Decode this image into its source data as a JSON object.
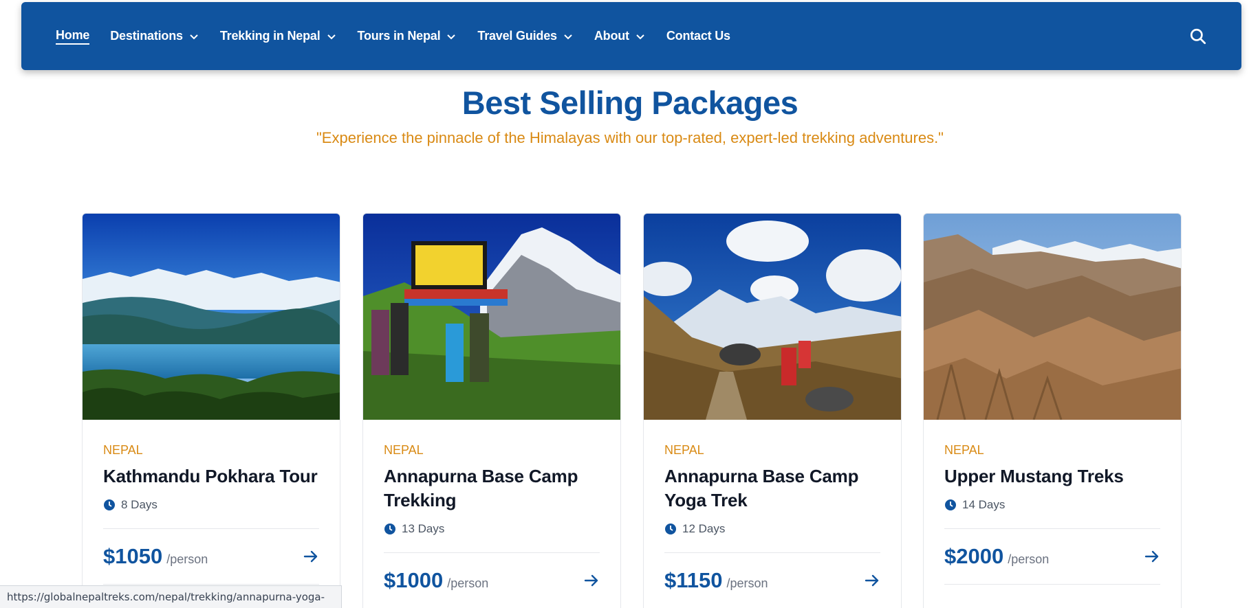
{
  "nav": {
    "items": [
      {
        "label": "Home",
        "active": true,
        "dropdown": false
      },
      {
        "label": "Destinations",
        "active": false,
        "dropdown": true
      },
      {
        "label": "Trekking in Nepal",
        "active": false,
        "dropdown": true
      },
      {
        "label": "Tours in Nepal",
        "active": false,
        "dropdown": true
      },
      {
        "label": "Travel Guides",
        "active": false,
        "dropdown": true
      },
      {
        "label": "About",
        "active": false,
        "dropdown": true
      },
      {
        "label": "Contact Us",
        "active": false,
        "dropdown": false
      }
    ],
    "search_icon": "search-icon"
  },
  "section": {
    "title": "Best Selling Packages",
    "subtitle": "\"Experience the pinnacle of the Himalayas with our top-rated, expert-led trekking adventures.\""
  },
  "cards": [
    {
      "country": "NEPAL",
      "title": "Kathmandu Pokhara Tour",
      "days": "8 Days",
      "price": "$1050",
      "per": "/person"
    },
    {
      "country": "NEPAL",
      "title": "Annapurna Base Camp Trekking",
      "days": "13 Days",
      "price": "$1000",
      "per": "/person"
    },
    {
      "country": "NEPAL",
      "title": "Annapurna Base Camp Yoga Trek",
      "days": "12 Days",
      "price": "$1150",
      "per": "/person"
    },
    {
      "country": "NEPAL",
      "title": "Upper Mustang Treks",
      "days": "14 Days",
      "price": "$2000",
      "per": "/person"
    }
  ],
  "status_bar": {
    "url": "https://globalnepaltreks.com/nepal/trekking/annapurna-yoga-trek"
  },
  "colors": {
    "brand_blue": "#10549f",
    "accent_orange": "#d98a14"
  }
}
